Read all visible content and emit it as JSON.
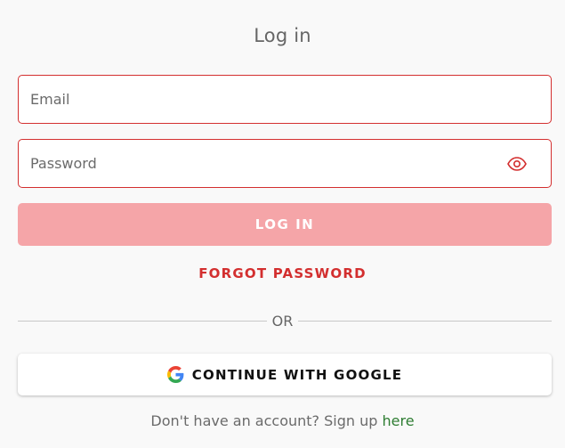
{
  "title": "Log in",
  "email_field": {
    "placeholder": "Email",
    "value": ""
  },
  "password_field": {
    "placeholder": "Password",
    "value": "",
    "toggle_icon": "eye-icon"
  },
  "login_button": {
    "label": "LOG IN"
  },
  "forgot_password": {
    "label": "FORGOT PASSWORD"
  },
  "divider": {
    "label": "OR"
  },
  "google_button": {
    "label": "CONTINUE WITH GOOGLE",
    "icon": "google-logo-icon"
  },
  "signup": {
    "prompt": "Don't have an account? Sign up",
    "link": "here"
  },
  "colors": {
    "accent": "#d32f2f",
    "login_button_bg": "#f5a5a8",
    "link_green": "#2e7d32",
    "background": "#f9f9f9"
  }
}
